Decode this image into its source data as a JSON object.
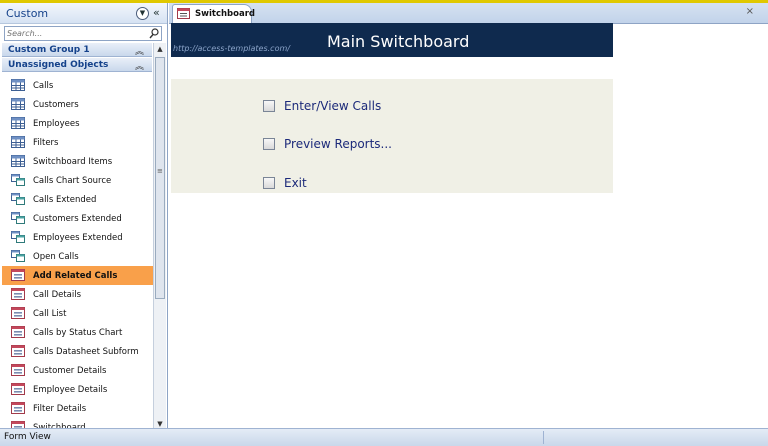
{
  "nav": {
    "title": "Custom",
    "search_placeholder": "Search...",
    "groups": [
      {
        "label": "Custom Group 1"
      },
      {
        "label": "Unassigned Objects"
      }
    ],
    "items": [
      {
        "label": "Calls",
        "icon": "table-icon"
      },
      {
        "label": "Customers",
        "icon": "table-icon"
      },
      {
        "label": "Employees",
        "icon": "table-icon"
      },
      {
        "label": "Filters",
        "icon": "table-icon"
      },
      {
        "label": "Switchboard Items",
        "icon": "table-icon"
      },
      {
        "label": "Calls Chart Source",
        "icon": "query-icon"
      },
      {
        "label": "Calls Extended",
        "icon": "query-icon"
      },
      {
        "label": "Customers Extended",
        "icon": "query-icon"
      },
      {
        "label": "Employees Extended",
        "icon": "query-icon"
      },
      {
        "label": "Open Calls",
        "icon": "query-icon"
      },
      {
        "label": "Add Related Calls",
        "icon": "form-icon",
        "selected": true
      },
      {
        "label": "Call Details",
        "icon": "form-icon"
      },
      {
        "label": "Call List",
        "icon": "form-icon"
      },
      {
        "label": "Calls by Status Chart",
        "icon": "form-icon"
      },
      {
        "label": "Calls Datasheet Subform",
        "icon": "form-icon"
      },
      {
        "label": "Customer Details",
        "icon": "form-icon"
      },
      {
        "label": "Employee Details",
        "icon": "form-icon"
      },
      {
        "label": "Filter Details",
        "icon": "form-icon"
      },
      {
        "label": "Switchboard",
        "icon": "form-icon"
      }
    ]
  },
  "document": {
    "tab_label": "Switchboard",
    "banner_url": "http://access-templates.com/",
    "banner_title": "Main Switchboard",
    "options": [
      {
        "label": "Enter/View Calls"
      },
      {
        "label": "Preview Reports..."
      },
      {
        "label": "Exit"
      }
    ]
  },
  "status": {
    "text": "Form View"
  },
  "colors": {
    "banner": "#0f2a4e",
    "selected": "#f9a04a",
    "panel": "#f0f0e6",
    "accent": "#15428b"
  }
}
